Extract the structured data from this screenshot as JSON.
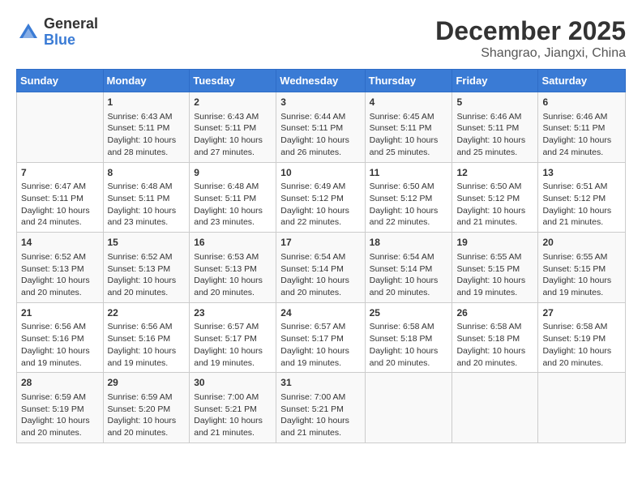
{
  "logo": {
    "general": "General",
    "blue": "Blue"
  },
  "title": "December 2025",
  "location": "Shangrao, Jiangxi, China",
  "days_of_week": [
    "Sunday",
    "Monday",
    "Tuesday",
    "Wednesday",
    "Thursday",
    "Friday",
    "Saturday"
  ],
  "weeks": [
    [
      {
        "day": "",
        "sunrise": "",
        "sunset": "",
        "daylight": ""
      },
      {
        "day": "1",
        "sunrise": "Sunrise: 6:43 AM",
        "sunset": "Sunset: 5:11 PM",
        "daylight": "Daylight: 10 hours and 28 minutes."
      },
      {
        "day": "2",
        "sunrise": "Sunrise: 6:43 AM",
        "sunset": "Sunset: 5:11 PM",
        "daylight": "Daylight: 10 hours and 27 minutes."
      },
      {
        "day": "3",
        "sunrise": "Sunrise: 6:44 AM",
        "sunset": "Sunset: 5:11 PM",
        "daylight": "Daylight: 10 hours and 26 minutes."
      },
      {
        "day": "4",
        "sunrise": "Sunrise: 6:45 AM",
        "sunset": "Sunset: 5:11 PM",
        "daylight": "Daylight: 10 hours and 25 minutes."
      },
      {
        "day": "5",
        "sunrise": "Sunrise: 6:46 AM",
        "sunset": "Sunset: 5:11 PM",
        "daylight": "Daylight: 10 hours and 25 minutes."
      },
      {
        "day": "6",
        "sunrise": "Sunrise: 6:46 AM",
        "sunset": "Sunset: 5:11 PM",
        "daylight": "Daylight: 10 hours and 24 minutes."
      }
    ],
    [
      {
        "day": "7",
        "sunrise": "Sunrise: 6:47 AM",
        "sunset": "Sunset: 5:11 PM",
        "daylight": "Daylight: 10 hours and 24 minutes."
      },
      {
        "day": "8",
        "sunrise": "Sunrise: 6:48 AM",
        "sunset": "Sunset: 5:11 PM",
        "daylight": "Daylight: 10 hours and 23 minutes."
      },
      {
        "day": "9",
        "sunrise": "Sunrise: 6:48 AM",
        "sunset": "Sunset: 5:11 PM",
        "daylight": "Daylight: 10 hours and 23 minutes."
      },
      {
        "day": "10",
        "sunrise": "Sunrise: 6:49 AM",
        "sunset": "Sunset: 5:12 PM",
        "daylight": "Daylight: 10 hours and 22 minutes."
      },
      {
        "day": "11",
        "sunrise": "Sunrise: 6:50 AM",
        "sunset": "Sunset: 5:12 PM",
        "daylight": "Daylight: 10 hours and 22 minutes."
      },
      {
        "day": "12",
        "sunrise": "Sunrise: 6:50 AM",
        "sunset": "Sunset: 5:12 PM",
        "daylight": "Daylight: 10 hours and 21 minutes."
      },
      {
        "day": "13",
        "sunrise": "Sunrise: 6:51 AM",
        "sunset": "Sunset: 5:12 PM",
        "daylight": "Daylight: 10 hours and 21 minutes."
      }
    ],
    [
      {
        "day": "14",
        "sunrise": "Sunrise: 6:52 AM",
        "sunset": "Sunset: 5:13 PM",
        "daylight": "Daylight: 10 hours and 20 minutes."
      },
      {
        "day": "15",
        "sunrise": "Sunrise: 6:52 AM",
        "sunset": "Sunset: 5:13 PM",
        "daylight": "Daylight: 10 hours and 20 minutes."
      },
      {
        "day": "16",
        "sunrise": "Sunrise: 6:53 AM",
        "sunset": "Sunset: 5:13 PM",
        "daylight": "Daylight: 10 hours and 20 minutes."
      },
      {
        "day": "17",
        "sunrise": "Sunrise: 6:54 AM",
        "sunset": "Sunset: 5:14 PM",
        "daylight": "Daylight: 10 hours and 20 minutes."
      },
      {
        "day": "18",
        "sunrise": "Sunrise: 6:54 AM",
        "sunset": "Sunset: 5:14 PM",
        "daylight": "Daylight: 10 hours and 20 minutes."
      },
      {
        "day": "19",
        "sunrise": "Sunrise: 6:55 AM",
        "sunset": "Sunset: 5:15 PM",
        "daylight": "Daylight: 10 hours and 19 minutes."
      },
      {
        "day": "20",
        "sunrise": "Sunrise: 6:55 AM",
        "sunset": "Sunset: 5:15 PM",
        "daylight": "Daylight: 10 hours and 19 minutes."
      }
    ],
    [
      {
        "day": "21",
        "sunrise": "Sunrise: 6:56 AM",
        "sunset": "Sunset: 5:16 PM",
        "daylight": "Daylight: 10 hours and 19 minutes."
      },
      {
        "day": "22",
        "sunrise": "Sunrise: 6:56 AM",
        "sunset": "Sunset: 5:16 PM",
        "daylight": "Daylight: 10 hours and 19 minutes."
      },
      {
        "day": "23",
        "sunrise": "Sunrise: 6:57 AM",
        "sunset": "Sunset: 5:17 PM",
        "daylight": "Daylight: 10 hours and 19 minutes."
      },
      {
        "day": "24",
        "sunrise": "Sunrise: 6:57 AM",
        "sunset": "Sunset: 5:17 PM",
        "daylight": "Daylight: 10 hours and 19 minutes."
      },
      {
        "day": "25",
        "sunrise": "Sunrise: 6:58 AM",
        "sunset": "Sunset: 5:18 PM",
        "daylight": "Daylight: 10 hours and 20 minutes."
      },
      {
        "day": "26",
        "sunrise": "Sunrise: 6:58 AM",
        "sunset": "Sunset: 5:18 PM",
        "daylight": "Daylight: 10 hours and 20 minutes."
      },
      {
        "day": "27",
        "sunrise": "Sunrise: 6:58 AM",
        "sunset": "Sunset: 5:19 PM",
        "daylight": "Daylight: 10 hours and 20 minutes."
      }
    ],
    [
      {
        "day": "28",
        "sunrise": "Sunrise: 6:59 AM",
        "sunset": "Sunset: 5:19 PM",
        "daylight": "Daylight: 10 hours and 20 minutes."
      },
      {
        "day": "29",
        "sunrise": "Sunrise: 6:59 AM",
        "sunset": "Sunset: 5:20 PM",
        "daylight": "Daylight: 10 hours and 20 minutes."
      },
      {
        "day": "30",
        "sunrise": "Sunrise: 7:00 AM",
        "sunset": "Sunset: 5:21 PM",
        "daylight": "Daylight: 10 hours and 21 minutes."
      },
      {
        "day": "31",
        "sunrise": "Sunrise: 7:00 AM",
        "sunset": "Sunset: 5:21 PM",
        "daylight": "Daylight: 10 hours and 21 minutes."
      },
      {
        "day": "",
        "sunrise": "",
        "sunset": "",
        "daylight": ""
      },
      {
        "day": "",
        "sunrise": "",
        "sunset": "",
        "daylight": ""
      },
      {
        "day": "",
        "sunrise": "",
        "sunset": "",
        "daylight": ""
      }
    ]
  ]
}
